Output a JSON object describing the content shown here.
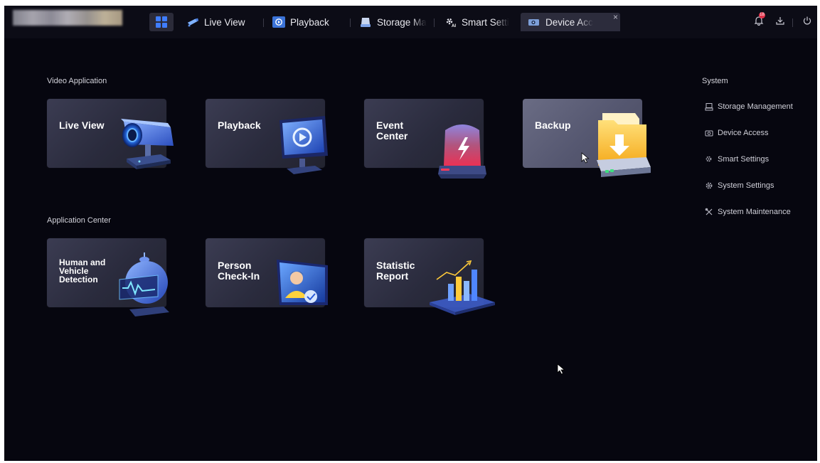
{
  "tabs": [
    {
      "label": "Live View",
      "icon": "camera-icon"
    },
    {
      "label": "Playback",
      "icon": "playback-icon"
    },
    {
      "label": "Storage Ma",
      "icon": "storage-icon"
    },
    {
      "label": "Smart Setti",
      "icon": "smart-settings-icon"
    },
    {
      "label": "Device Acc",
      "icon": "device-access-icon",
      "active": true
    }
  ],
  "close_glyph": "×",
  "alarm_badge": "18",
  "sections": {
    "video": {
      "title": "Video Application"
    },
    "apps": {
      "title": "Application Center"
    },
    "system": {
      "title": "System"
    }
  },
  "video_cards": [
    {
      "label": "Live View"
    },
    {
      "label": "Playback"
    },
    {
      "label": "Event\nCenter"
    },
    {
      "label": "Backup"
    }
  ],
  "app_cards": [
    {
      "label": "Human and\nVehicle\nDetection"
    },
    {
      "label": "Person\nCheck-In"
    },
    {
      "label": "Statistic\nReport"
    }
  ],
  "system_menu": [
    {
      "label": "Storage Management",
      "icon": "storage-icon"
    },
    {
      "label": "Device Access",
      "icon": "device-access-icon"
    },
    {
      "label": "Smart Settings",
      "icon": "smart-settings-icon"
    },
    {
      "label": "System Settings",
      "icon": "system-settings-icon"
    },
    {
      "label": "System Maintenance",
      "icon": "maintenance-icon"
    }
  ],
  "colors": {
    "background": "#06060f",
    "accent": "#3f7dff",
    "alarm": "#e0324a"
  }
}
